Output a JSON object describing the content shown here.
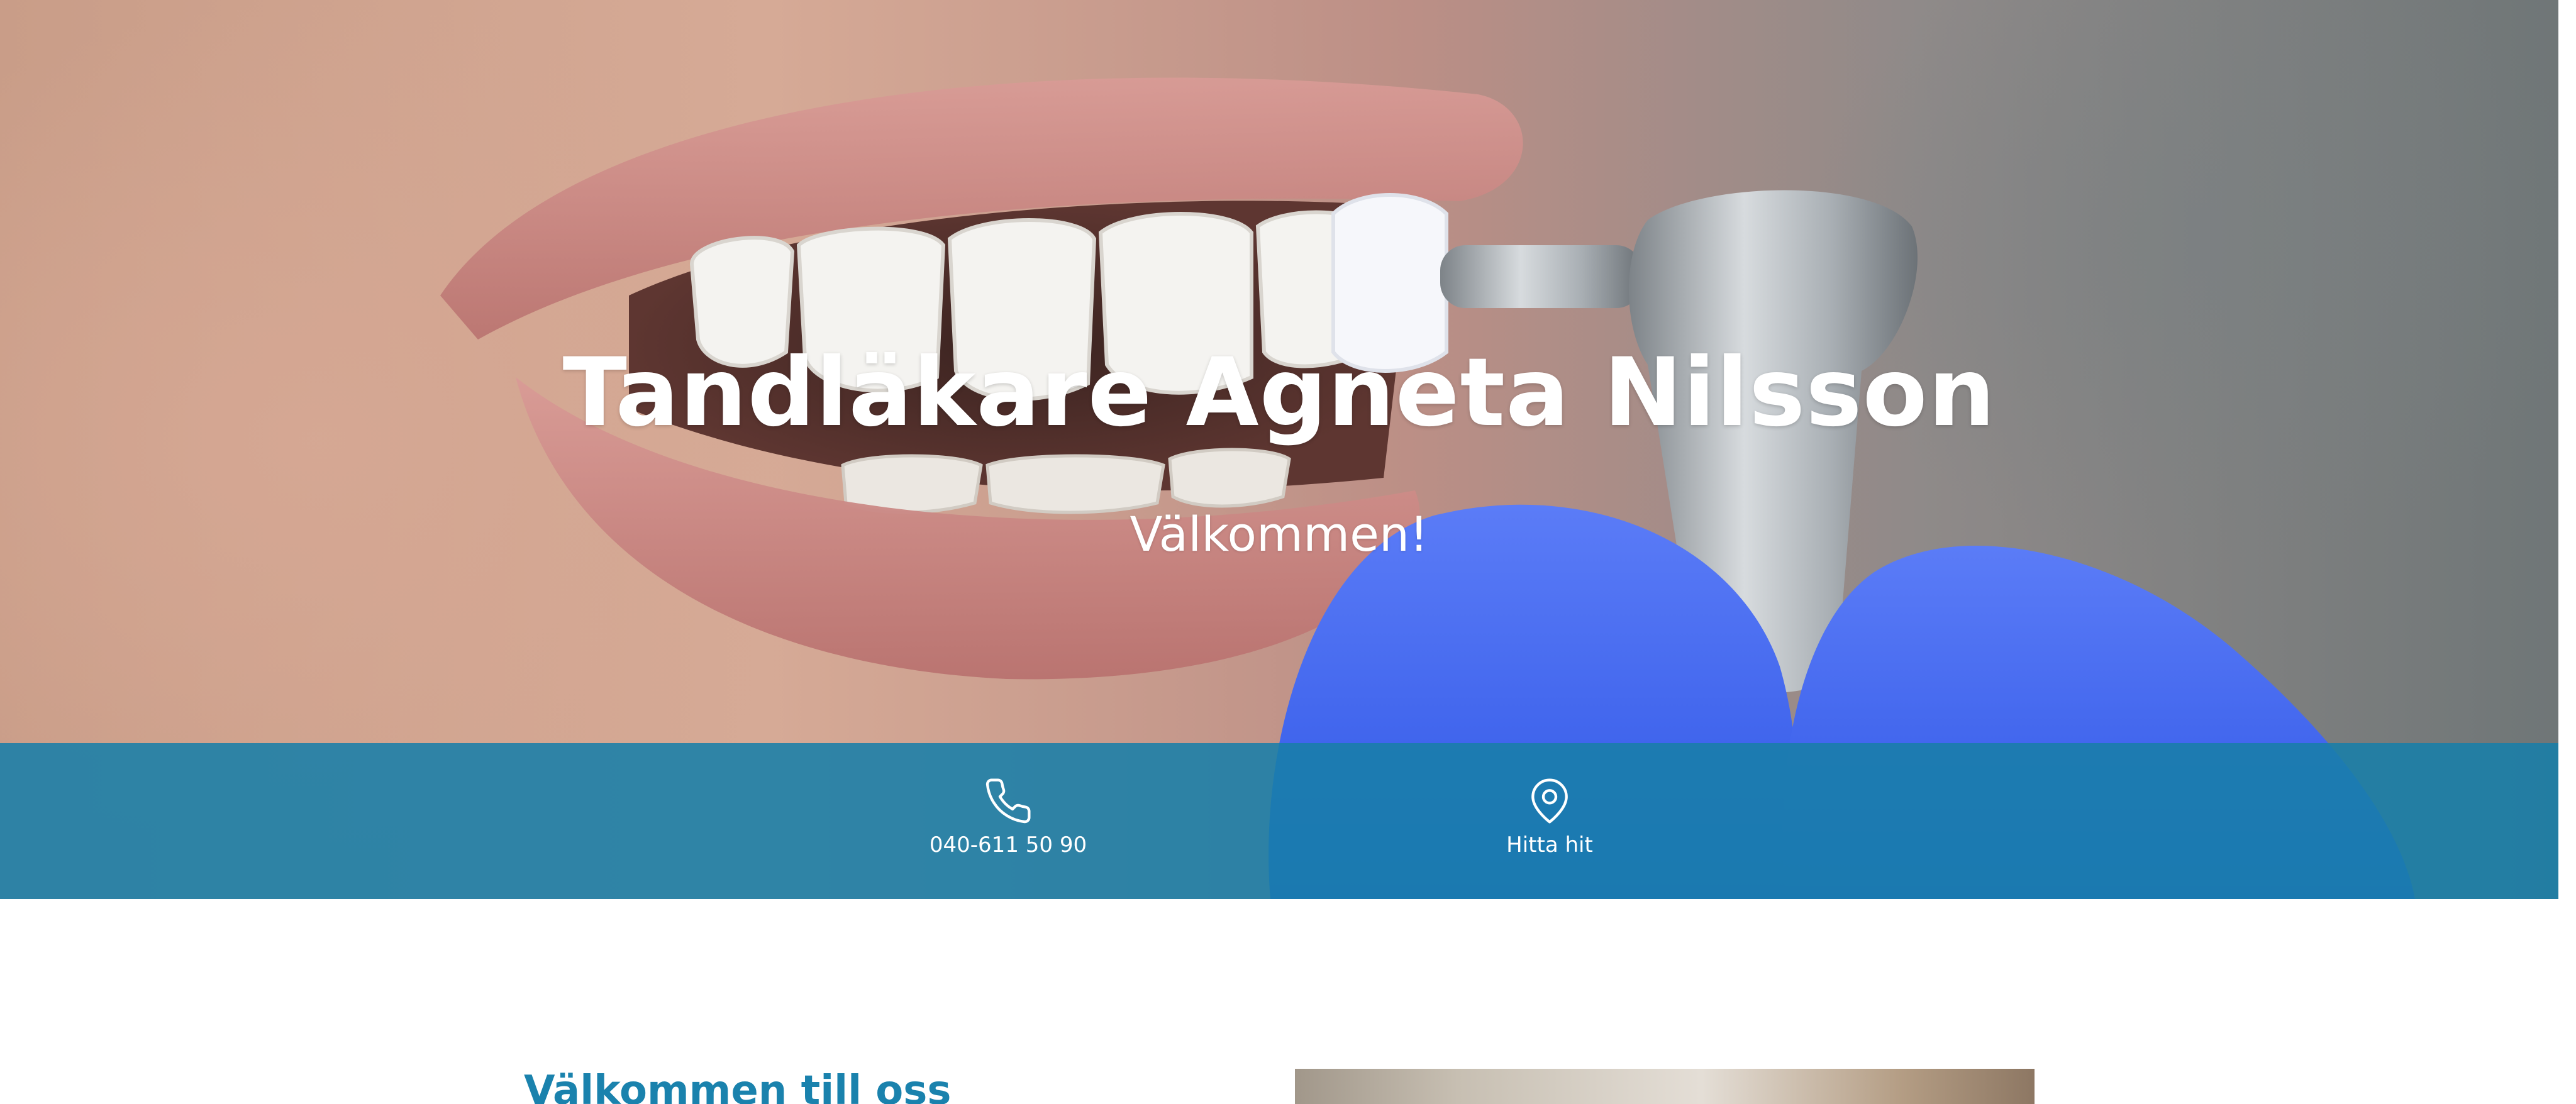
{
  "hero": {
    "title": "Tandläkare Agneta Nilsson",
    "subtitle": "Välkommen!"
  },
  "info_bar": {
    "phone": {
      "icon": "phone-icon",
      "label": "040-611 50 90"
    },
    "location": {
      "icon": "map-pin-icon",
      "label": "Hitta hit"
    },
    "color": "#1f82ad"
  },
  "welcome": {
    "heading": "Välkommen till oss"
  },
  "colors": {
    "accent": "#1a82ad",
    "glove": "#4a6ff0",
    "text_on_hero": "#ffffff"
  }
}
